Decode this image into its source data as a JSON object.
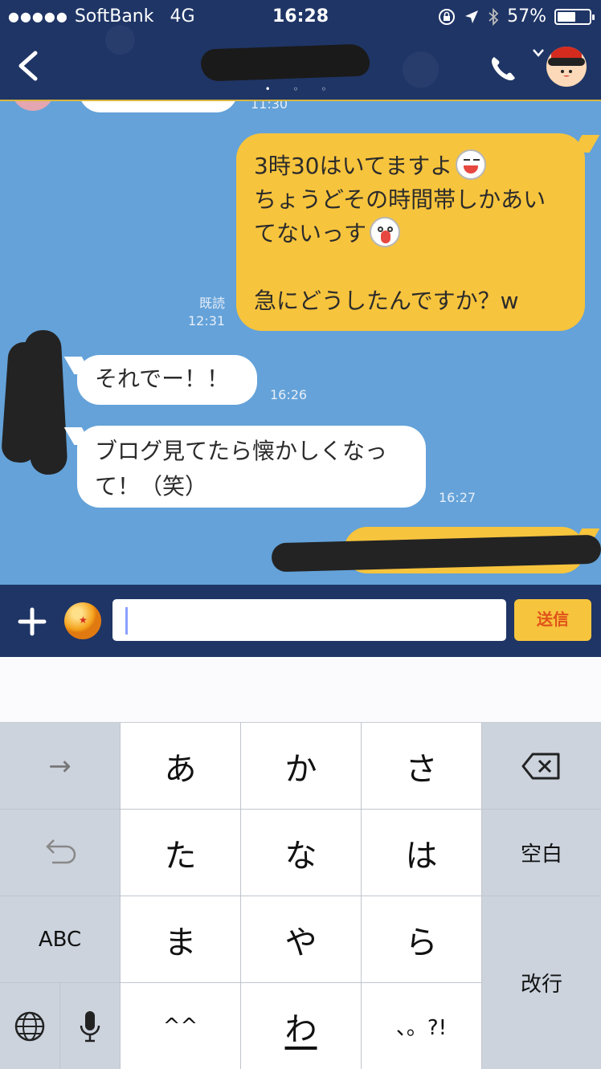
{
  "status_bar": {
    "carrier": "SoftBank",
    "network": "4G",
    "time": "16:28",
    "battery": "57%",
    "battery_level": 0.57
  },
  "header": {
    "page_indicator": "• ◦ ◦"
  },
  "chat": {
    "partial_top_time": "11:30",
    "outgoing_message": {
      "line1": "3時30はいてますよ",
      "line2": "ちょうどその時間帯しかあい",
      "line3": "てないっす",
      "line4": "急にどうしたんですか？w",
      "read_label": "既読",
      "time": "12:31"
    },
    "incoming_1": {
      "text": "それでー！！",
      "time": "16:26"
    },
    "incoming_2": {
      "line1": "ブログ見てたら懐かしくなっ",
      "line2": "て！（笑）",
      "time": "16:27"
    }
  },
  "input_bar": {
    "send_label": "送信",
    "text_value": ""
  },
  "keyboard": {
    "arrow": "→",
    "undo": "↺",
    "abc": "ABC",
    "row1": [
      "あ",
      "か",
      "さ"
    ],
    "row2": [
      "た",
      "な",
      "は"
    ],
    "row3": [
      "ま",
      "や",
      "ら"
    ],
    "row4": [
      "^^",
      "わ",
      "、。?!"
    ],
    "space": "空白",
    "return": "改行"
  },
  "colors": {
    "header_bg": "#1f3566",
    "chat_bg": "#64a2d9",
    "outgoing_bubble": "#f7c43d",
    "send_text": "#e0531b"
  }
}
